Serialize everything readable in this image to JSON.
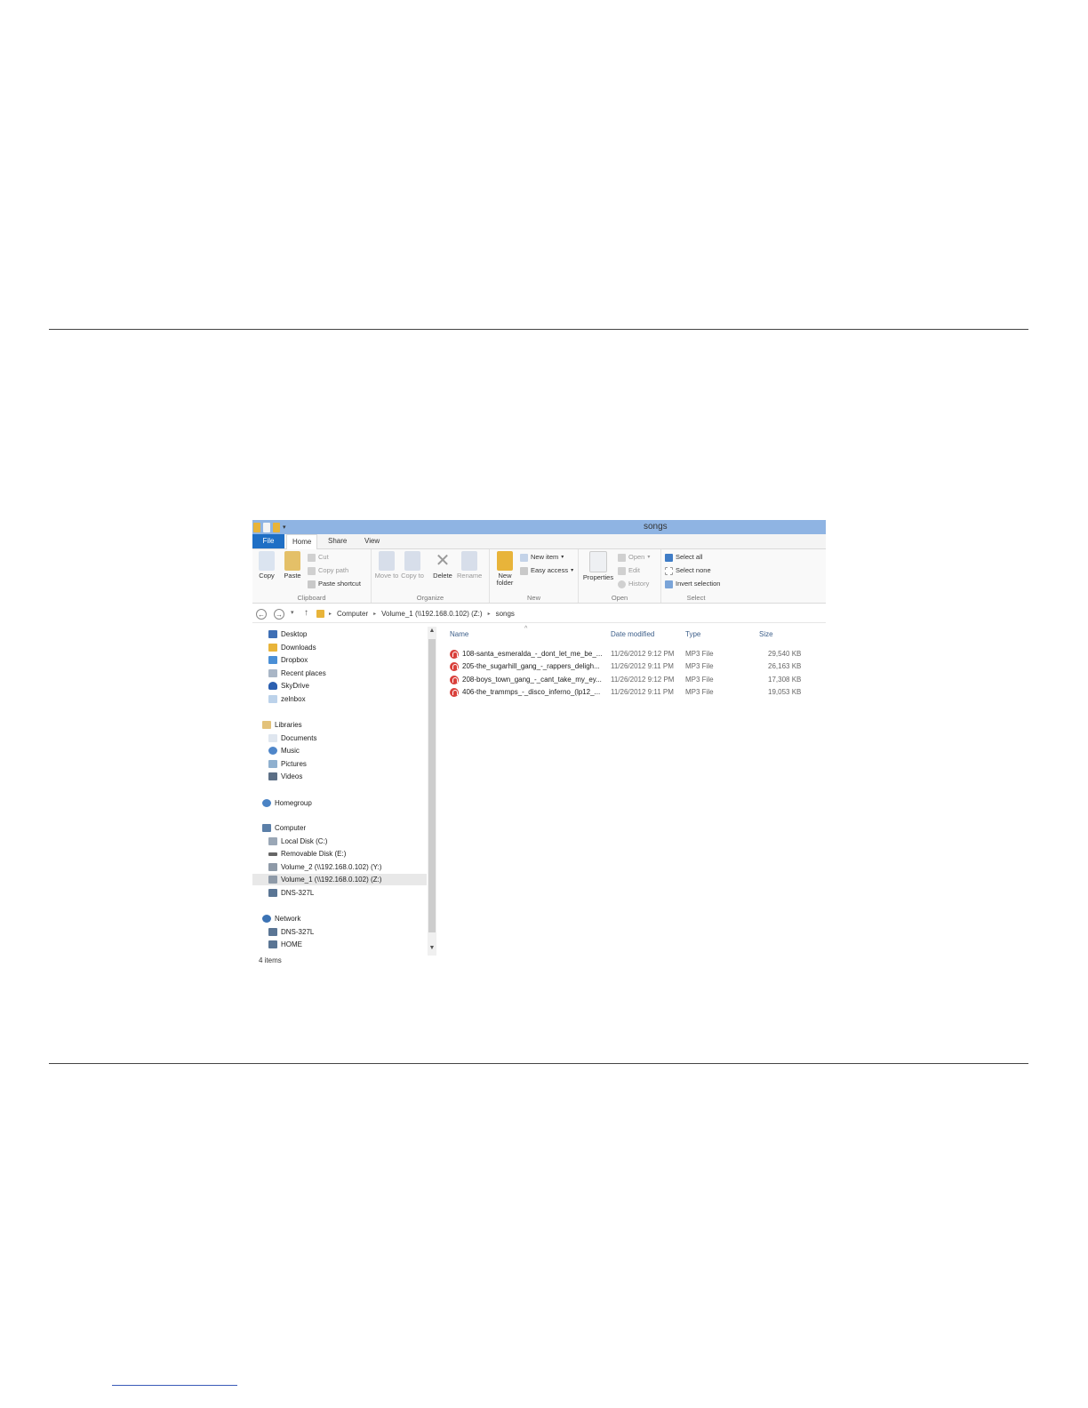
{
  "window": {
    "title": "songs"
  },
  "ribbon_tabs": [
    "File",
    "Home",
    "Share",
    "View"
  ],
  "ribbon": {
    "clipboard": {
      "name": "Clipboard",
      "copy": "Copy",
      "paste": "Paste",
      "cut": "Cut",
      "copy_path": "Copy path",
      "paste_shortcut": "Paste shortcut"
    },
    "organize": {
      "name": "Organize",
      "move_to": "Move to",
      "copy_to": "Copy to",
      "delete": "Delete",
      "rename": "Rename"
    },
    "new": {
      "name": "New",
      "new_folder": "New folder",
      "new_item": "New item",
      "easy_access": "Easy access"
    },
    "open": {
      "name": "Open",
      "properties": "Properties",
      "open": "Open",
      "edit": "Edit",
      "history": "History"
    },
    "select": {
      "name": "Select",
      "select_all": "Select all",
      "select_none": "Select none",
      "invert_selection": "Invert selection"
    }
  },
  "address": {
    "crumbs": [
      "Computer",
      "Volume_1 (\\\\192.168.0.102) (Z:)",
      "songs"
    ]
  },
  "nav": {
    "favorites": [
      "Desktop",
      "Downloads",
      "Dropbox",
      "Recent places",
      "SkyDrive",
      "zelnbox"
    ],
    "libraries": {
      "label": "Libraries",
      "items": [
        "Documents",
        "Music",
        "Pictures",
        "Videos"
      ]
    },
    "homegroup": "Homegroup",
    "computer": {
      "label": "Computer",
      "items": [
        "Local Disk (C:)",
        "Removable Disk (E:)",
        "Volume_2 (\\\\192.168.0.102) (Y:)",
        "Volume_1 (\\\\192.168.0.102) (Z:)",
        "DNS-327L"
      ]
    },
    "network": {
      "label": "Network",
      "items": [
        "DNS-327L",
        "HOME"
      ]
    }
  },
  "columns": {
    "name": "Name",
    "date": "Date modified",
    "type": "Type",
    "size": "Size"
  },
  "files": [
    {
      "name": "108-santa_esmeralda_-_dont_let_me_be_...",
      "date": "11/26/2012 9:12 PM",
      "type": "MP3 File",
      "size": "29,540 KB"
    },
    {
      "name": "205-the_sugarhill_gang_-_rappers_deligh...",
      "date": "11/26/2012 9:11 PM",
      "type": "MP3 File",
      "size": "26,163 KB"
    },
    {
      "name": "208-boys_town_gang_-_cant_take_my_ey...",
      "date": "11/26/2012 9:12 PM",
      "type": "MP3 File",
      "size": "17,308 KB"
    },
    {
      "name": "406-the_trammps_-_disco_inferno_(lp12_...",
      "date": "11/26/2012 9:11 PM",
      "type": "MP3 File",
      "size": "19,053 KB"
    }
  ],
  "status": "4 items",
  "colors": {
    "titlebar": "#8fb4e3",
    "file_tab": "#1f6fc5",
    "mp3_icon": "#d9403b"
  }
}
